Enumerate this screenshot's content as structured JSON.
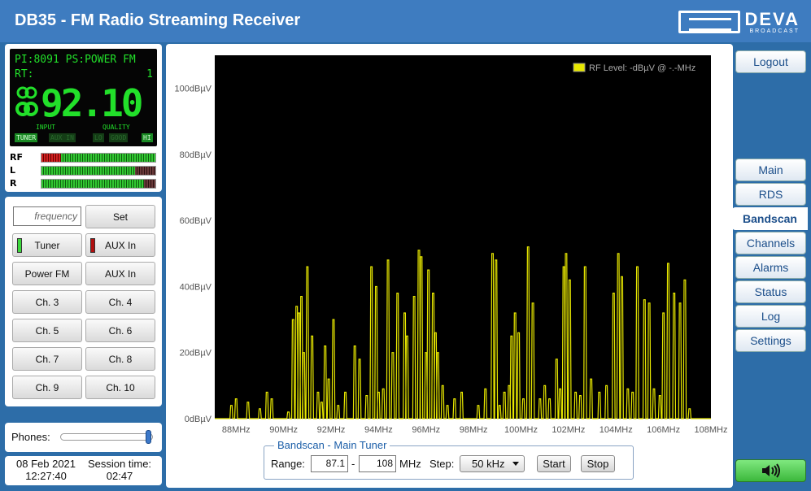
{
  "header": {
    "title": "DB35 - FM Radio Streaming Receiver",
    "logo_text": "DEVA",
    "logo_sub": "BROADCAST"
  },
  "lcd": {
    "pi_label": "PI:",
    "pi_value": "8091",
    "ps_label": "PS:",
    "ps_value": "POWER FM",
    "rt_label": "RT:",
    "rt_value": "1",
    "frequency": "92.10",
    "input_label": "INPUT",
    "quality_label": "QUALITY",
    "indicators": [
      "TUNER",
      "AUX IN",
      "LO",
      "GOOD",
      "HI"
    ],
    "indicator_state": [
      true,
      false,
      false,
      false,
      true
    ]
  },
  "meters": [
    {
      "label": "RF",
      "red_fraction": 0.17,
      "dark_fraction": 0.0
    },
    {
      "label": "L",
      "red_fraction": 0.0,
      "dark_fraction": 0.18
    },
    {
      "label": "R",
      "red_fraction": 0.0,
      "dark_fraction": 0.1
    }
  ],
  "controls": {
    "frequency_placeholder": "frequency",
    "set_label": "Set",
    "tuner_label": "Tuner",
    "tuner_led_color": "#3cd83c",
    "aux_label": "AUX In",
    "aux_led_color": "#b01010",
    "channels": [
      "Power FM",
      "AUX In",
      "Ch. 3",
      "Ch. 4",
      "Ch. 5",
      "Ch. 6",
      "Ch. 7",
      "Ch. 8",
      "Ch. 9",
      "Ch. 10"
    ]
  },
  "phones": {
    "label": "Phones:",
    "volume_fraction": 1.0
  },
  "status": {
    "date": "08 Feb 2021",
    "time": "12:27:40",
    "session_label": "Session time:",
    "session_value": "02:47"
  },
  "nav": {
    "logout": "Logout",
    "items": [
      "Main",
      "RDS",
      "Bandscan",
      "Channels",
      "Alarms",
      "Status",
      "Log",
      "Settings"
    ],
    "active": "Bandscan",
    "audio_icon": "speaker-icon"
  },
  "bandscan": {
    "legend": "Bandscan - Main Tuner",
    "range_label": "Range:",
    "range_from": "87.1",
    "range_sep": "-",
    "range_to": "108",
    "unit": "MHz",
    "step_label": "Step:",
    "step_value": "50 kHz",
    "start_label": "Start",
    "stop_label": "Stop"
  },
  "chart_data": {
    "type": "line",
    "legend": "RF Level: -dBµV @ -.-MHz",
    "series_color": "#e8e800",
    "background": "#000000",
    "xlim": [
      87.1,
      108
    ],
    "ylim": [
      0,
      110
    ],
    "x_ticks": [
      "88MHz",
      "90MHz",
      "92MHz",
      "94MHz",
      "96MHz",
      "98MHz",
      "100MHz",
      "102MHz",
      "104MHz",
      "106MHz",
      "108MHz"
    ],
    "y_ticks": [
      "0dBµV",
      "20dBµV",
      "40dBµV",
      "60dBµV",
      "80dBµV",
      "100dBµV"
    ],
    "peaks": [
      [
        87.8,
        4
      ],
      [
        88.0,
        6
      ],
      [
        88.5,
        5
      ],
      [
        89.0,
        3
      ],
      [
        89.3,
        8
      ],
      [
        89.5,
        6
      ],
      [
        90.2,
        2
      ],
      [
        90.4,
        30
      ],
      [
        90.55,
        34
      ],
      [
        90.65,
        32
      ],
      [
        90.75,
        37
      ],
      [
        90.85,
        20
      ],
      [
        91.0,
        46
      ],
      [
        91.2,
        25
      ],
      [
        91.45,
        8
      ],
      [
        91.6,
        5
      ],
      [
        91.75,
        22
      ],
      [
        91.9,
        12
      ],
      [
        92.1,
        30
      ],
      [
        92.3,
        4
      ],
      [
        92.6,
        8
      ],
      [
        93.0,
        22
      ],
      [
        93.2,
        18
      ],
      [
        93.5,
        7
      ],
      [
        93.7,
        46
      ],
      [
        93.9,
        40
      ],
      [
        94.0,
        8
      ],
      [
        94.2,
        9
      ],
      [
        94.4,
        48
      ],
      [
        94.6,
        20
      ],
      [
        94.8,
        38
      ],
      [
        95.1,
        32
      ],
      [
        95.2,
        25
      ],
      [
        95.5,
        37
      ],
      [
        95.7,
        51
      ],
      [
        95.8,
        49
      ],
      [
        96.0,
        20
      ],
      [
        96.1,
        45
      ],
      [
        96.3,
        38
      ],
      [
        96.4,
        26
      ],
      [
        96.5,
        20
      ],
      [
        96.7,
        10
      ],
      [
        96.9,
        4
      ],
      [
        97.2,
        6
      ],
      [
        97.5,
        8
      ],
      [
        98.2,
        4
      ],
      [
        98.5,
        9
      ],
      [
        98.8,
        50
      ],
      [
        98.95,
        48
      ],
      [
        99.1,
        4
      ],
      [
        99.3,
        8
      ],
      [
        99.5,
        10
      ],
      [
        99.6,
        25
      ],
      [
        99.75,
        32
      ],
      [
        99.9,
        26
      ],
      [
        100.1,
        6
      ],
      [
        100.3,
        52
      ],
      [
        100.5,
        35
      ],
      [
        100.8,
        6
      ],
      [
        101.0,
        10
      ],
      [
        101.2,
        6
      ],
      [
        101.5,
        18
      ],
      [
        101.65,
        9
      ],
      [
        101.8,
        46
      ],
      [
        101.9,
        50
      ],
      [
        102.05,
        42
      ],
      [
        102.3,
        8
      ],
      [
        102.5,
        7
      ],
      [
        102.7,
        46
      ],
      [
        102.95,
        12
      ],
      [
        103.3,
        8
      ],
      [
        103.6,
        10
      ],
      [
        103.9,
        38
      ],
      [
        104.1,
        50
      ],
      [
        104.25,
        43
      ],
      [
        104.5,
        9
      ],
      [
        104.7,
        8
      ],
      [
        104.9,
        46
      ],
      [
        105.2,
        36
      ],
      [
        105.4,
        35
      ],
      [
        105.6,
        9
      ],
      [
        105.85,
        7
      ],
      [
        106.0,
        32
      ],
      [
        106.2,
        47
      ],
      [
        106.45,
        38
      ],
      [
        106.7,
        35
      ],
      [
        106.9,
        42
      ],
      [
        107.1,
        3
      ]
    ]
  }
}
